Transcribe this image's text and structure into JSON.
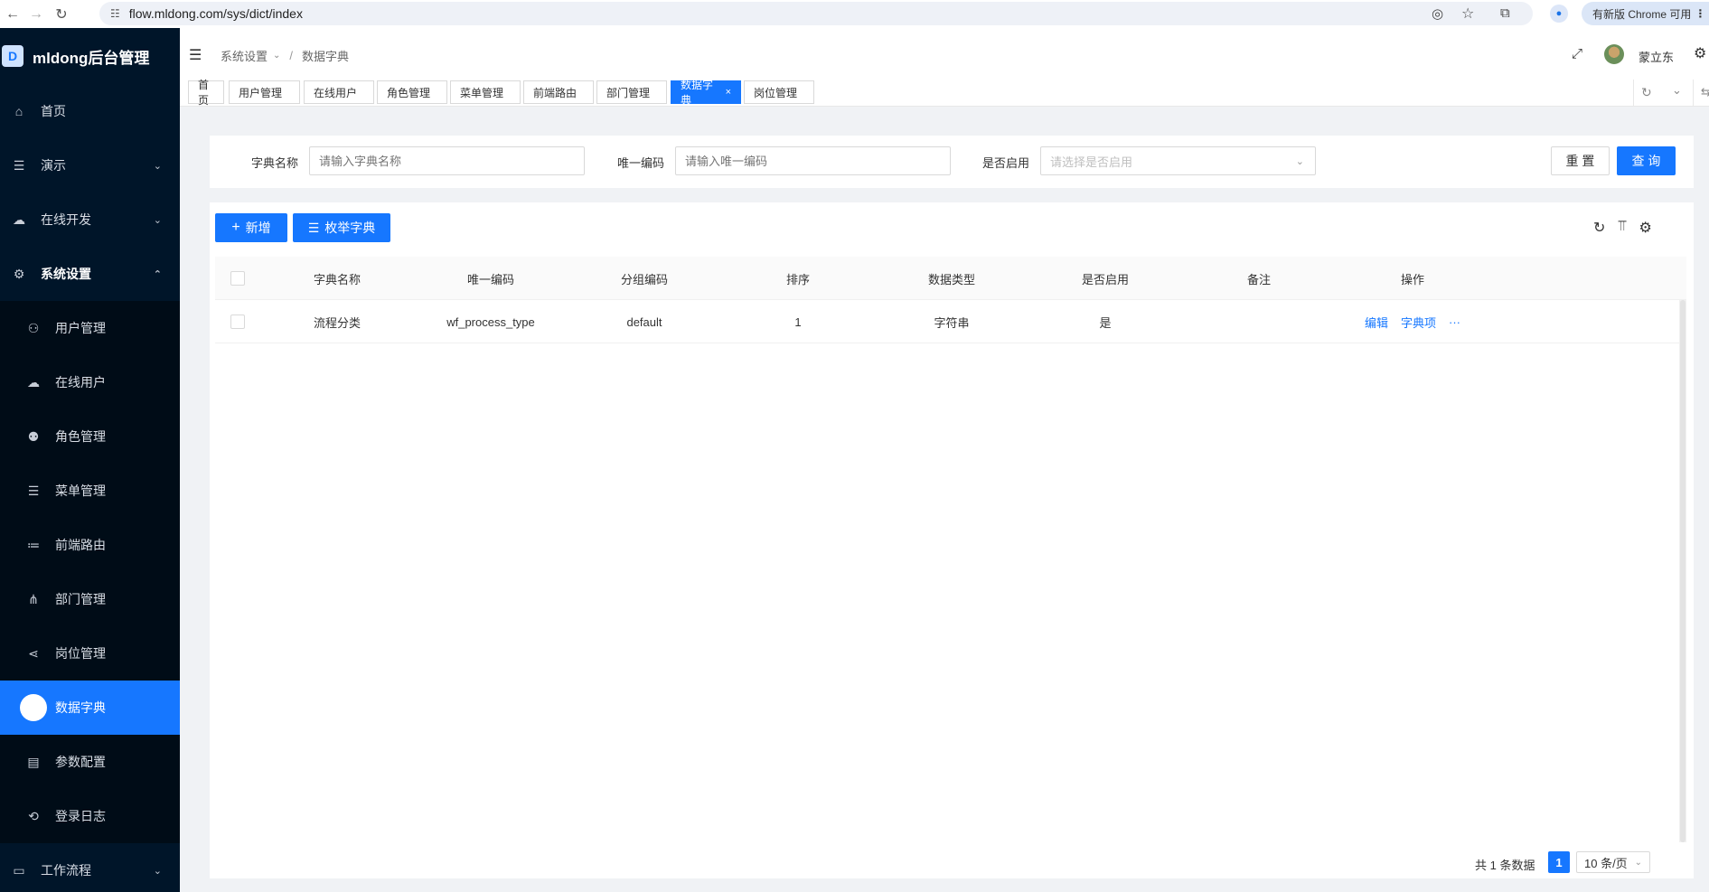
{
  "browser": {
    "url": "flow.mldong.com/sys/dict/index",
    "update_label": "有新版 Chrome 可用"
  },
  "app": {
    "title": "mldong后台管理",
    "logo_letter": "D"
  },
  "sidebar": {
    "items": [
      {
        "label": "首页",
        "icon": "home-icon",
        "glyph": "⌂"
      },
      {
        "label": "演示",
        "icon": "list-icon",
        "glyph": "☰",
        "chevron": "⌄"
      },
      {
        "label": "在线开发",
        "icon": "cloud-icon",
        "glyph": "☁",
        "chevron": "⌄"
      },
      {
        "label": "系统设置",
        "icon": "gear-icon",
        "glyph": "⚙",
        "chevron": "⌃"
      }
    ],
    "submenu": [
      {
        "label": "用户管理",
        "icon": "user-icon",
        "glyph": "⚇"
      },
      {
        "label": "在线用户",
        "icon": "cloud-user-icon",
        "glyph": "☁"
      },
      {
        "label": "角色管理",
        "icon": "role-icon",
        "glyph": "⚉"
      },
      {
        "label": "菜单管理",
        "icon": "menu-icon",
        "glyph": "☰"
      },
      {
        "label": "前端路由",
        "icon": "route-icon",
        "glyph": "≔"
      },
      {
        "label": "部门管理",
        "icon": "org-icon",
        "glyph": "⋔"
      },
      {
        "label": "岗位管理",
        "icon": "share-icon",
        "glyph": "⋖"
      },
      {
        "label": "数据字典",
        "icon": "dict-icon",
        "glyph": "",
        "active": true
      },
      {
        "label": "参数配置",
        "icon": "file-icon",
        "glyph": "▤"
      },
      {
        "label": "登录日志",
        "icon": "login-icon",
        "glyph": "⟲"
      }
    ],
    "bottom": {
      "label": "工作流程",
      "icon": "laptop-icon",
      "glyph": "▭",
      "chevron": "⌄"
    }
  },
  "header": {
    "breadcrumb": [
      "系统设置",
      "数据字典"
    ],
    "username": "蒙立东"
  },
  "tabs": [
    {
      "label": "首页"
    },
    {
      "label": "用户管理"
    },
    {
      "label": "在线用户"
    },
    {
      "label": "角色管理"
    },
    {
      "label": "菜单管理"
    },
    {
      "label": "前端路由"
    },
    {
      "label": "部门管理"
    },
    {
      "label": "数据字典",
      "active": true,
      "close": "×"
    },
    {
      "label": "岗位管理"
    }
  ],
  "search": {
    "name_label": "字典名称",
    "name_placeholder": "请输入字典名称",
    "code_label": "唯一编码",
    "code_placeholder": "请输入唯一编码",
    "enabled_label": "是否启用",
    "enabled_placeholder": "请选择是否启用",
    "reset_label": "重 置",
    "query_label": "查 询"
  },
  "toolbar": {
    "add_label": "新增",
    "enum_label": "枚举字典"
  },
  "table": {
    "columns": [
      "字典名称",
      "唯一编码",
      "分组编码",
      "排序",
      "数据类型",
      "是否启用",
      "备注",
      "操作"
    ],
    "rows": [
      {
        "name": "流程分类",
        "code": "wf_process_type",
        "group": "default",
        "sort": "1",
        "data_type": "字符串",
        "enabled": "是",
        "remark": "",
        "actions": {
          "edit": "编辑",
          "items": "字典项",
          "more": "···"
        }
      }
    ]
  },
  "pagination": {
    "total_text": "共 1 条数据",
    "current_page": "1",
    "page_size": "10 条/页"
  },
  "colors": {
    "primary": "#1677ff",
    "sidebar_bg": "#001529",
    "submenu_bg": "#000c17"
  }
}
